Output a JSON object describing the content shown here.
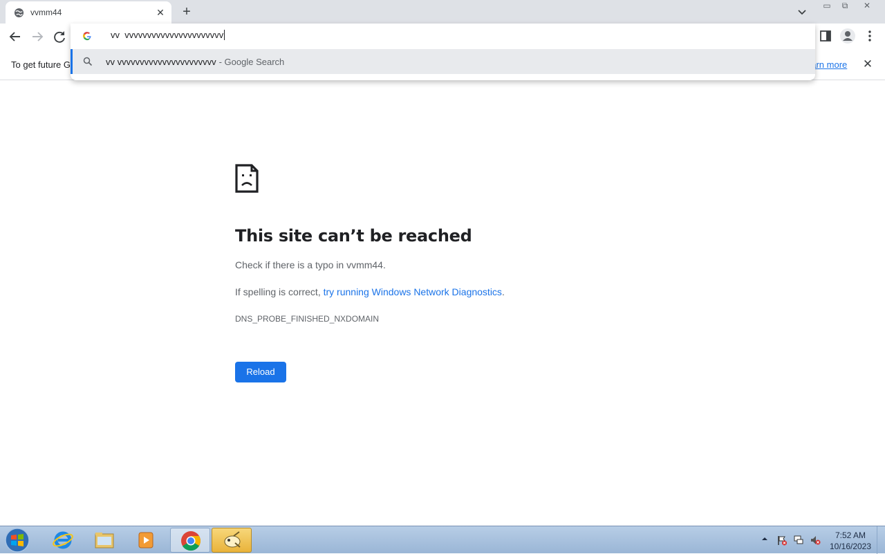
{
  "tab": {
    "title": "vvmm44",
    "close_glyph": "✕"
  },
  "new_tab_glyph": "+",
  "window_controls": {
    "minimize": "▭",
    "restore": "⧉",
    "close": "✕"
  },
  "omnibox": {
    "text": "vv  vvvvvvvvvvvvvvvvvvvvvv",
    "suggestion_query": "vv vvvvvvvvvvvvvvvvvvvvvv",
    "suggestion_suffix": " - Google Search"
  },
  "infobar": {
    "text": "To get future G",
    "link": "earn more",
    "close_glyph": "✕"
  },
  "error": {
    "title": "This site can’t be reached",
    "check": "Check if there is a typo in vvmm44.",
    "spelling_prefix": "If spelling is correct, ",
    "spelling_link": "try running Windows Network Diagnostics",
    "spelling_suffix": ".",
    "code": "DNS_PROBE_FINISHED_NXDOMAIN",
    "reload": "Reload"
  },
  "taskbar": {
    "items": [
      "windows-start",
      "internet-explorer",
      "file-explorer",
      "media-player",
      "chrome",
      "paint-app"
    ],
    "time": "7:52 AM",
    "date": "10/16/2023"
  },
  "colors": {
    "accent": "#1a73e8",
    "tab_strip": "#dee1e6",
    "taskbar": "#b7cde6"
  }
}
